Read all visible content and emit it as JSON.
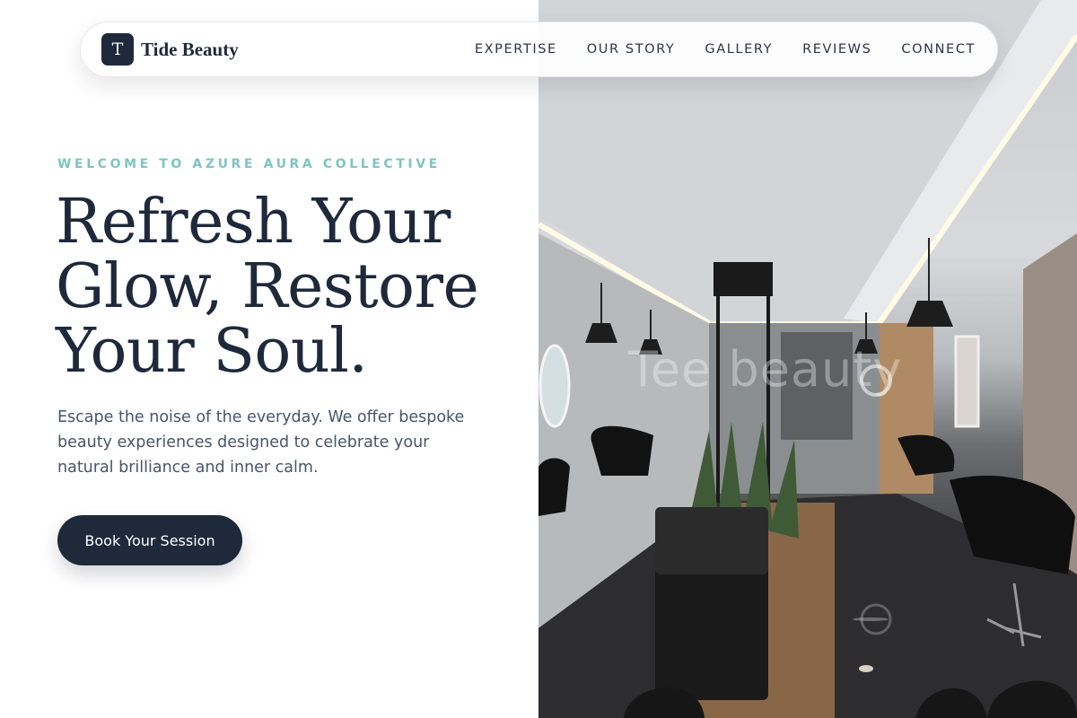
{
  "brand": {
    "mark": "T",
    "name": "Tide Beauty"
  },
  "nav": {
    "links": [
      {
        "label": "EXPERTISE"
      },
      {
        "label": "OUR STORY"
      },
      {
        "label": "GALLERY"
      },
      {
        "label": "REVIEWS"
      },
      {
        "label": "CONNECT"
      }
    ]
  },
  "hero": {
    "eyebrow": "WELCOME TO AZURE AURA COLLECTIVE",
    "headline_lines": [
      "Refresh Your",
      "Glow, Restore",
      "Your Soul."
    ],
    "subtext": "Escape the noise of the everyday. We offer bespoke beauty experiences designed to celebrate your natural brilliance and inner calm.",
    "cta_label": "Book Your Session",
    "image_watermark": "Tee beauty"
  },
  "colors": {
    "navy": "#1e293b",
    "teal_accent": "#7ec4c0",
    "body_text": "#475569"
  }
}
